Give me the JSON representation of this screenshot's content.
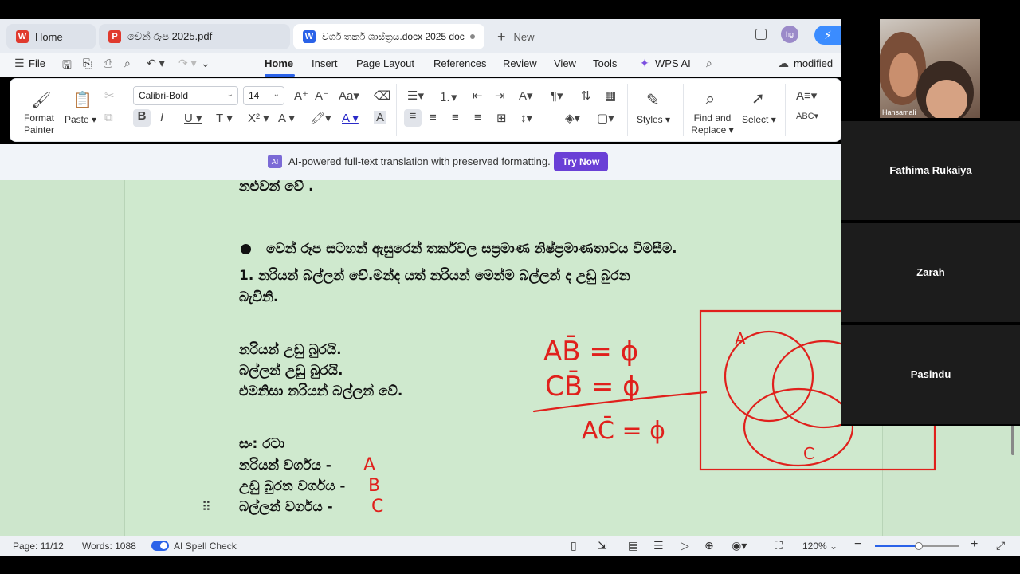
{
  "tabs": {
    "home": "Home",
    "pdf": "වෙන් රූප 2025.pdf",
    "doc": "වර්ග තර්ක ශාස්ත්‍රය.docx  2025  doc",
    "new": "New"
  },
  "avatar": "hg",
  "menu": {
    "file": "File",
    "items": [
      "Home",
      "Insert",
      "Page Layout",
      "References",
      "Review",
      "View",
      "Tools"
    ],
    "wps_ai": "WPS AI",
    "modified": "modified"
  },
  "ribbon": {
    "format_painter": "Format Painter",
    "paste": "Paste",
    "font": "Calibri-Bold",
    "size": "14",
    "styles": "Styles",
    "find_replace_1": "Find and",
    "find_replace_2": "Replace",
    "select": "Select"
  },
  "banner": {
    "text": "AI-powered full-text translation with preserved formatting.",
    "button": "Try Now"
  },
  "document": {
    "line0": "නළුවන් වේ .",
    "heading": "වෙන් රූප සටහන් ඇසුරෙන් තර්කවල සප්‍රමාණ නිෂ්ප්‍රමාණතාවය විමසීම.",
    "line1": "1. නරියන් බල්ලන් වේ.මන්ද යත් නරියන් මෙන්ම බල්ලන් ද උඩු බුරන",
    "line2": "බැවිනි.",
    "line3": "නරියන් උඩු බුරයි.",
    "line4": "බල්ලන් උඩු බුරයි.",
    "line5": "එමනිසා නරියන් බල්ලන් වේ.",
    "line6": "සං: රටා",
    "line7": "නරියන් වර්ගය -",
    "line8": "උඩු බුරන වර්ගය -",
    "line9": "බල්ලන් වර්ගය -"
  },
  "ink_text": {
    "eq1": "AB̄ = ϕ",
    "eq2": "CB̄ = ϕ",
    "eq3": "AC̄ = ϕ",
    "a": "A",
    "b": "B",
    "c": "C"
  },
  "status": {
    "page": "Page: 11/12",
    "words": "Words: 1088",
    "spell": "AI Spell Check",
    "zoom": "120%",
    "zoom_fraction": 0.52
  },
  "video": {
    "cam_name": "Hansamali",
    "p1": "Fathima Rukaiya",
    "p2": "Zarah",
    "p3": "Pasindu"
  },
  "colors": {
    "accent": "#2a62e8",
    "ink": "#e0201c",
    "page_bg": "#cfe9ce"
  }
}
